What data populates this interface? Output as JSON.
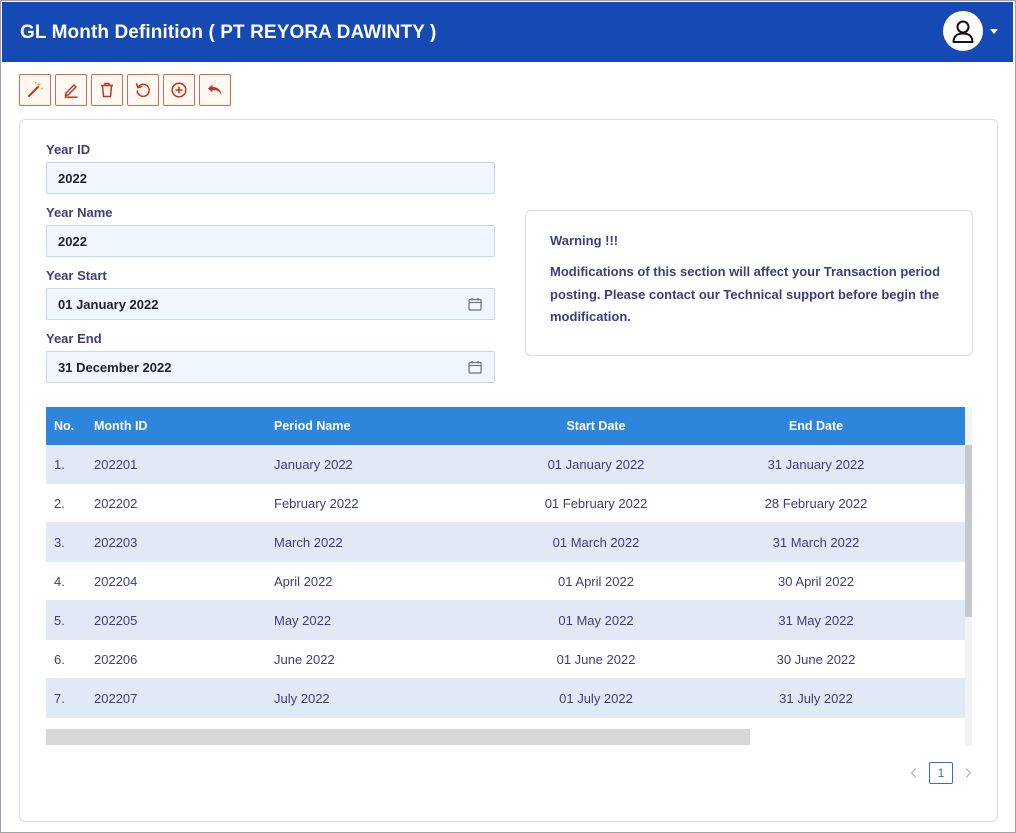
{
  "header": {
    "title": "GL Month Definition ( PT REYORA DAWINTY )"
  },
  "toolbar": {
    "buttons": [
      {
        "icon": "magic-wand-icon"
      },
      {
        "icon": "edit-icon"
      },
      {
        "icon": "trash-icon"
      },
      {
        "icon": "refresh-icon"
      },
      {
        "icon": "add-circle-icon"
      },
      {
        "icon": "undo-icon"
      }
    ],
    "accent": "#d9694a"
  },
  "form": {
    "year_id_label": "Year ID",
    "year_id_value": "2022",
    "year_name_label": "Year Name",
    "year_name_value": "2022",
    "year_start_label": "Year Start",
    "year_start_value": "01 January 2022",
    "year_end_label": "Year End",
    "year_end_value": "31 December 2022"
  },
  "warning": {
    "title": "Warning !!!",
    "text": "Modifications of this section will affect your Transaction period posting. Please contact our Technical support before begin the modification."
  },
  "grid": {
    "columns": [
      "No.",
      "Month ID",
      "Period Name",
      "Start Date",
      "End Date"
    ],
    "rows": [
      {
        "no": "1.",
        "month_id": "202201",
        "period": "January 2022",
        "start": "01 January 2022",
        "end": "31 January 2022"
      },
      {
        "no": "2.",
        "month_id": "202202",
        "period": "February 2022",
        "start": "01 February 2022",
        "end": "28 February 2022"
      },
      {
        "no": "3.",
        "month_id": "202203",
        "period": "March 2022",
        "start": "01 March 2022",
        "end": "31 March 2022"
      },
      {
        "no": "4.",
        "month_id": "202204",
        "period": "April 2022",
        "start": "01 April 2022",
        "end": "30 April 2022"
      },
      {
        "no": "5.",
        "month_id": "202205",
        "period": "May 2022",
        "start": "01 May 2022",
        "end": "31 May 2022"
      },
      {
        "no": "6.",
        "month_id": "202206",
        "period": "June 2022",
        "start": "01 June 2022",
        "end": "30 June 2022"
      },
      {
        "no": "7.",
        "month_id": "202207",
        "period": "July 2022",
        "start": "01 July 2022",
        "end": "31 July 2022"
      }
    ]
  },
  "pager": {
    "current_page": "1"
  },
  "colors": {
    "header_bg": "#1549b3",
    "grid_header_bg": "#2e86dc",
    "row_alt_bg": "#dfeaf6",
    "label_color": "#3d3f7a"
  }
}
